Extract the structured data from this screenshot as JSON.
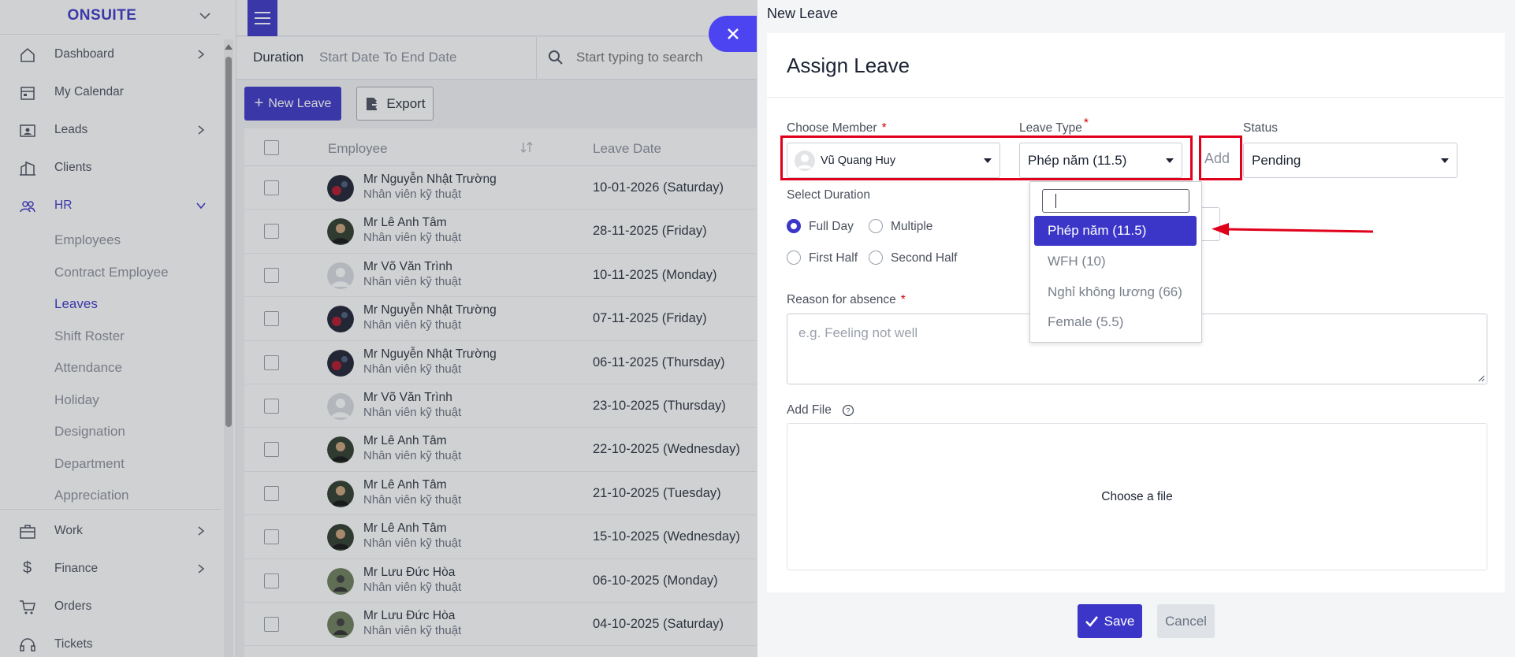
{
  "sidebar": {
    "brand": "ONSUITE",
    "menu": [
      {
        "label": "Dashboard",
        "icon": "house-icon",
        "chevron": true
      },
      {
        "label": "My Calendar",
        "icon": "calendar-icon",
        "chevron": false
      },
      {
        "label": "Leads",
        "icon": "contact-card-icon",
        "chevron": true
      },
      {
        "label": "Clients",
        "icon": "building-icon",
        "chevron": false
      },
      {
        "label": "HR",
        "icon": "people-icon",
        "chevron": true,
        "expanded": true
      }
    ],
    "hr_items": [
      "Employees",
      "Contract Employee",
      "Leaves",
      "Shift Roster",
      "Attendance",
      "Holiday",
      "Designation",
      "Department",
      "Appreciation"
    ],
    "active_hr_item": "Leaves",
    "menu_bottom": [
      {
        "label": "Work",
        "icon": "briefcase-icon",
        "chevron": true
      },
      {
        "label": "Finance",
        "icon": "dollar-icon",
        "chevron": true
      },
      {
        "label": "Orders",
        "icon": "cart-icon",
        "chevron": false
      },
      {
        "label": "Tickets",
        "icon": "headset-icon",
        "chevron": false
      }
    ]
  },
  "filters": {
    "duration_label": "Duration",
    "date_range": "Start Date To End Date",
    "search_placeholder": "Start typing to search"
  },
  "toolbar": {
    "new_leave": "New Leave",
    "export": "Export"
  },
  "table": {
    "columns": [
      "Employee",
      "Leave Date"
    ],
    "rows": [
      {
        "name": "Mr Nguyễn Nhật Trường",
        "position": "Nhân viên kỹ thuật",
        "date": "10-01-2026 (Saturday)",
        "avatar": "dark"
      },
      {
        "name": "Mr Lê Anh Tâm",
        "position": "Nhân viên kỹ thuật",
        "date": "28-11-2025 (Friday)",
        "avatar": "photo"
      },
      {
        "name": "Mr Võ Văn Trình",
        "position": "Nhân viên kỹ thuật",
        "date": "10-11-2025 (Monday)",
        "avatar": "default"
      },
      {
        "name": "Mr Nguyễn Nhật Trường",
        "position": "Nhân viên kỹ thuật",
        "date": "07-11-2025 (Friday)",
        "avatar": "dark"
      },
      {
        "name": "Mr Nguyễn Nhật Trường",
        "position": "Nhân viên kỹ thuật",
        "date": "06-11-2025 (Thursday)",
        "avatar": "dark"
      },
      {
        "name": "Mr Võ Văn Trình",
        "position": "Nhân viên kỹ thuật",
        "date": "23-10-2025 (Thursday)",
        "avatar": "default"
      },
      {
        "name": "Mr Lê Anh Tâm",
        "position": "Nhân viên kỹ thuật",
        "date": "22-10-2025 (Wednesday)",
        "avatar": "photo"
      },
      {
        "name": "Mr Lê Anh Tâm",
        "position": "Nhân viên kỹ thuật",
        "date": "21-10-2025 (Tuesday)",
        "avatar": "photo"
      },
      {
        "name": "Mr Lê Anh Tâm",
        "position": "Nhân viên kỹ thuật",
        "date": "15-10-2025 (Wednesday)",
        "avatar": "photo"
      },
      {
        "name": "Mr Lưu Đức Hòa",
        "position": "Nhân viên kỹ thuật",
        "date": "06-10-2025 (Monday)",
        "avatar": "outdoor"
      },
      {
        "name": "Mr Lưu Đức Hòa",
        "position": "Nhân viên kỹ thuật",
        "date": "04-10-2025 (Saturday)",
        "avatar": "outdoor"
      }
    ]
  },
  "panel": {
    "title": "New Leave",
    "card_title": "Assign Leave",
    "choose_member_label": "Choose Member",
    "member_value": "Vũ Quang Huy",
    "leave_type_label": "Leave Type",
    "leave_type_value": "Phép năm (11.5)",
    "add_label": "Add",
    "status_label": "Status",
    "status_value": "Pending",
    "select_duration_label": "Select Duration",
    "durations": [
      "Full Day",
      "Multiple",
      "First Half",
      "Second Half"
    ],
    "selected_duration": "Full Day",
    "reason_label": "Reason for absence",
    "reason_placeholder": "e.g. Feeling not well",
    "add_file_label": "Add File",
    "choose_file": "Choose a file",
    "save": "Save",
    "cancel": "Cancel",
    "required_mark": "*"
  },
  "dropdown": {
    "options": [
      "Phép năm (11.5)",
      "WFH (10)",
      "Nghỉ không lương (66)",
      "Female (5.5)"
    ],
    "selected": "Phép năm (11.5)"
  },
  "colors": {
    "primary": "#3b36c8",
    "highlight": "#e0001b",
    "close_button": "#4b44f0"
  }
}
